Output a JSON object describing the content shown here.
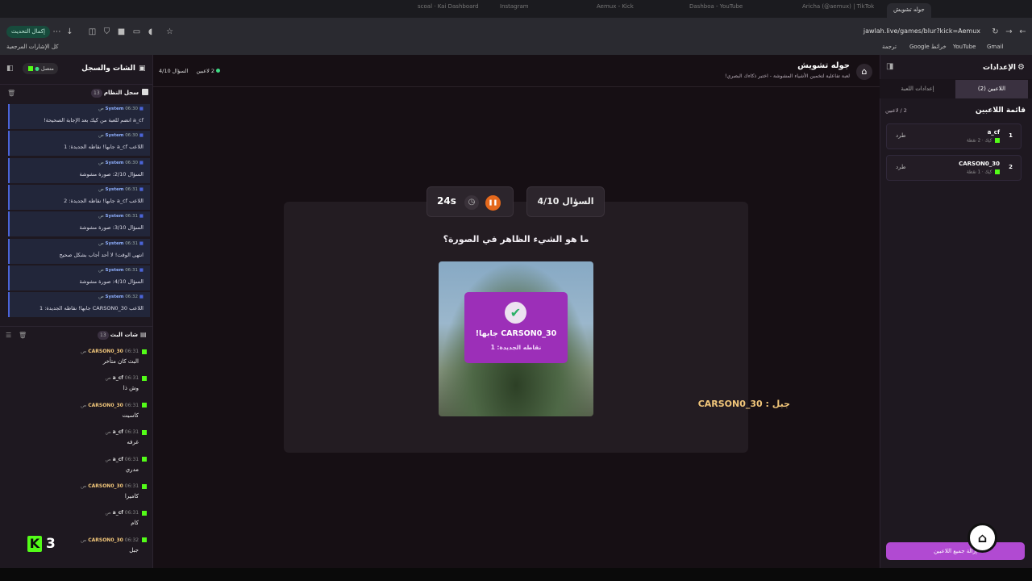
{
  "browser": {
    "tabs": [
      "scoal · Kai Dashboard",
      "Instagram",
      "Aemux - Kick",
      "Dashboa - YouTube",
      "Aricha (@aemux) | TikTok",
      "جوله تشويش"
    ],
    "update_label": "إكمال التحديث",
    "url": "jawlah.live/games/blur?kick=Aemux",
    "bookmarks": [
      "كل الإشارات المرجعية",
      "ترجمة",
      "Google خرائط",
      "YouTube",
      "Gmail"
    ]
  },
  "left": {
    "title": "الشات والسجل",
    "status": "متصل",
    "system_log_title": "سجل النظام",
    "system_log_count": "13",
    "system_items": [
      {
        "sender": "System",
        "time": "06:30 ص",
        "text": "a_cf انضم للعبة من كيك بعد الإجابة الصحيحة!"
      },
      {
        "sender": "System",
        "time": "06:30 ص",
        "text": "اللاعب a_cf جابها! نقاطه الجديدة: 1"
      },
      {
        "sender": "System",
        "time": "06:30 ص",
        "text": "السؤال 2/10: صورة مشوشة"
      },
      {
        "sender": "System",
        "time": "06:31 ص",
        "text": "اللاعب a_cf جابها! نقاطه الجديدة: 2"
      },
      {
        "sender": "System",
        "time": "06:31 ص",
        "text": "السؤال 3/10: صورة مشوشة"
      },
      {
        "sender": "System",
        "time": "06:31 ص",
        "text": "انتهى الوقت! لا أحد أجاب بشكل صحيح"
      },
      {
        "sender": "System",
        "time": "06:31 ص",
        "text": "السؤال 4/10: صورة مشوشة"
      },
      {
        "sender": "System",
        "time": "06:32 ص",
        "text": "اللاعب CARSON0_30 جابها! نقاطه الجديدة: 1"
      }
    ],
    "chat_title": "شات البث",
    "chat_count": "13",
    "chat_items": [
      {
        "user": "CARSON0_30",
        "time": "06:31 ص",
        "text": "البث كان متأخر",
        "gold": true
      },
      {
        "user": "a_cf",
        "time": "06:31 ص",
        "text": "وش ذا",
        "gold": false
      },
      {
        "user": "CARSON0_30",
        "time": "06:31 ص",
        "text": "كاسيت",
        "gold": true
      },
      {
        "user": "a_cf",
        "time": "06:31 ص",
        "text": "غرفه",
        "gold": false
      },
      {
        "user": "a_cf",
        "time": "06:31 ص",
        "text": "مدري",
        "gold": false
      },
      {
        "user": "CARSON0_30",
        "time": "06:31 ص",
        "text": "كاميرا",
        "gold": true
      },
      {
        "user": "a_cf",
        "time": "06:31 ص",
        "text": "كام",
        "gold": false
      },
      {
        "user": "CARSON0_30",
        "time": "06:32 ص",
        "text": "جبل",
        "gold": true
      }
    ],
    "viewer_count": "3"
  },
  "header": {
    "title": "جوله تشويش",
    "subtitle": "لعبة تفاعلية لتخمين الأشياء المشوشة - اختبر ذكاءك البصري!",
    "players_online": "2 لاعبين",
    "question_counter": "السؤال 4/10"
  },
  "game": {
    "question_label": "السؤال 4/10",
    "timer": "24s",
    "question": "ما هو الشيء الظاهر في الصورة؟",
    "winner_text": "CARSON0_30 جابها!",
    "winner_points": "نقاطه الجديدة: 1",
    "answer_line": "جبل : CARSON0_30"
  },
  "right": {
    "title": "الإعدادات",
    "tab_players": "اللاعبين (2)",
    "tab_settings": "إعدادات اللعبة",
    "list_title": "قائمة اللاعبين",
    "list_count": "2 / لاعبين",
    "players": [
      {
        "rank": "1",
        "name": "a_cf",
        "meta": "كيك · 2 نقطة",
        "kick": "طرد"
      },
      {
        "rank": "2",
        "name": "CARSON0_30",
        "meta": "كيك · 1 نقطة",
        "kick": "طرد"
      }
    ],
    "kick_all_label": "إزالة جميع اللاعبين"
  },
  "colors": {
    "accent": "#9c2fb8",
    "kick_green": "#53fc18",
    "timer_orange": "#e4681c",
    "answer_gold": "#f1c67a"
  }
}
